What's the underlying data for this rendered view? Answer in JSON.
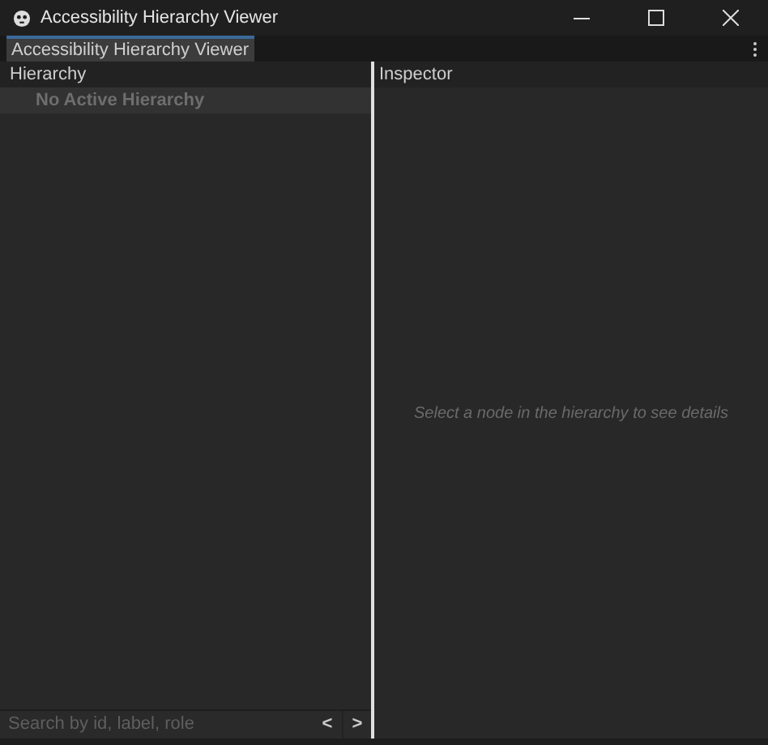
{
  "window": {
    "title": "Accessibility Hierarchy Viewer"
  },
  "tabs": [
    {
      "label": "Accessibility Hierarchy Viewer",
      "selected": true
    }
  ],
  "hierarchy": {
    "header": "Hierarchy",
    "items": [
      {
        "label": "No Active Hierarchy",
        "disabled": true
      }
    ],
    "search": {
      "placeholder": "Search by id, label, role"
    },
    "prev": "<",
    "next": ">"
  },
  "inspector": {
    "header": "Inspector",
    "empty_message": "Select a node in the hierarchy to see details"
  }
}
